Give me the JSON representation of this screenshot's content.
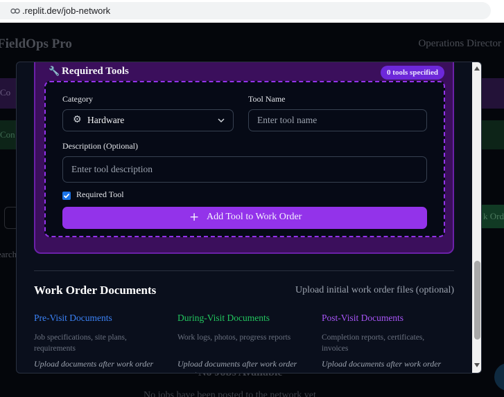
{
  "browser": {
    "url": ".replit.dev/job-network"
  },
  "app": {
    "title": "FieldOps Pro",
    "role": "Operations Director",
    "bg_bar1_text": "Co",
    "bg_bar2_text": "Con",
    "bg_green_btn": "k Ord",
    "bg_search": "earch",
    "no_jobs_title": "No Jobs Available",
    "no_jobs_sub": "No jobs have been posted to the network yet"
  },
  "tools": {
    "title": "Required Tools",
    "badge": "0 tools specified",
    "category_label": "Category",
    "category_value": "Hardware",
    "tool_name_label": "Tool Name",
    "tool_name_placeholder": "Enter tool name",
    "description_label": "Description (Optional)",
    "description_placeholder": "Enter tool description",
    "required_label": "Required Tool",
    "required_checked": true,
    "add_button": "Add Tool to Work Order"
  },
  "documents": {
    "title": "Work Order Documents",
    "subtitle": "Upload initial work order files (optional)",
    "columns": [
      {
        "title": "Pre-Visit Documents",
        "color": "#3b82f6",
        "description": "Job specifications, site plans, requirements",
        "note": "Upload documents after work order"
      },
      {
        "title": "During-Visit Documents",
        "color": "#22c55e",
        "description": "Work logs, photos, progress reports",
        "note": "Upload documents after work order creation"
      },
      {
        "title": "Post-Visit Documents",
        "color": "#a855f7",
        "description": "Completion reports, certificates, invoices",
        "note": "Upload documents after work order"
      }
    ]
  },
  "colors": {
    "accent_purple": "#9333ea",
    "section_bg": "#3b0f5c",
    "modal_bg": "#0a0f1c"
  }
}
